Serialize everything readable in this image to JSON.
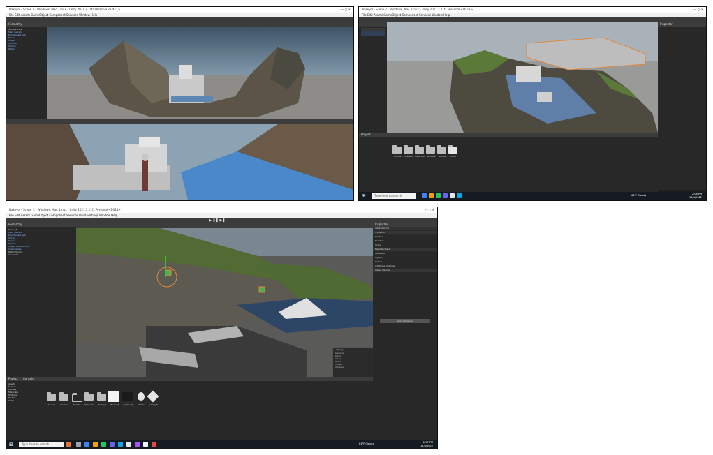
{
  "screenshot1": {
    "window_title": "Nakeyol - Scene 1 - Windows, Mac, Linux - Unity 2021.3.11f1 Personal <DX11>",
    "menu": "File  Edit  Assets  GameObject  Component  Services  Window  Help",
    "hierarchy_header": "Hierarchy",
    "hierarchy_items": [
      "SampleScene",
      "Main Camera",
      "Directional Light",
      "Terrain",
      "Player",
      "Camera",
      "Temple",
      "Water"
    ],
    "game_tab": "Game",
    "scene_tab": "Scene"
  },
  "screenshot2": {
    "window_title": "Nakeyol - Scene 2 - Windows, Mac, Linux - Unity 2021.3.11f1 Personal <DX11>",
    "menu": "File  Edit  Assets  GameObject  Component  Services  Window  Help",
    "project_header": "Project",
    "asset_names": [
      "Scenes",
      "Prefabs",
      "Materials",
      "Textures",
      "Models",
      "Unity"
    ],
    "inspector_header": "Inspector",
    "taskbar_search": "Type here to search",
    "clock_time": "2:06 PM",
    "clock_date": "12/4/2022",
    "weather": "64°F Cloudy"
  },
  "screenshot3": {
    "window_title": "Nakeyol - Scene_3 - Windows, Mac, Linux - Unity 2021.3.11f1 Personal <DX11>",
    "menu": "File  Edit  Assets  GameObject  Component  Services  Build Settings  Window  Help",
    "hierarchy_header": "Hierarchy",
    "hierarchy_items": [
      "Scene_3",
      "Main Camera",
      "Directional Light",
      "Terrain",
      "Player",
      "Temple",
      "PlayerFollowCamera",
      "Collectables",
      "WaterVolume",
      "CanvasUI"
    ],
    "project_header": "Project",
    "console_tab": "Console",
    "folders": [
      "Assets",
      "Scenes",
      "Prefabs",
      "Materials",
      "Textures",
      "Models",
      "Unity"
    ],
    "asset_tiles": [
      "Scenes",
      "Prefabs",
      "Scripts",
      "Materials",
      "Model_X",
      "Effects_Ts",
      "Sprites_Ts",
      "Water",
      "Unity_E"
    ],
    "inspector_header": "Inspector",
    "inspector_object": "WaterVolume",
    "transform_header": "Transform",
    "inspector_rows": [
      "Position",
      "Rotation",
      "Scale",
      "Mesh Renderer",
      "Materials",
      "Lighting",
      "Probes",
      "Additional Settings",
      "Water Volume",
      "Add Component"
    ],
    "lighting_overlay": [
      "Lighting",
      "Realtime",
      "Baked",
      "Mixed",
      "Direct",
      "Indirect",
      "Shadows"
    ],
    "taskbar_search": "Type here to search",
    "weather": "64°F Cloudy",
    "clock_time": "2:07 PM",
    "clock_date": "12/4/2022"
  }
}
